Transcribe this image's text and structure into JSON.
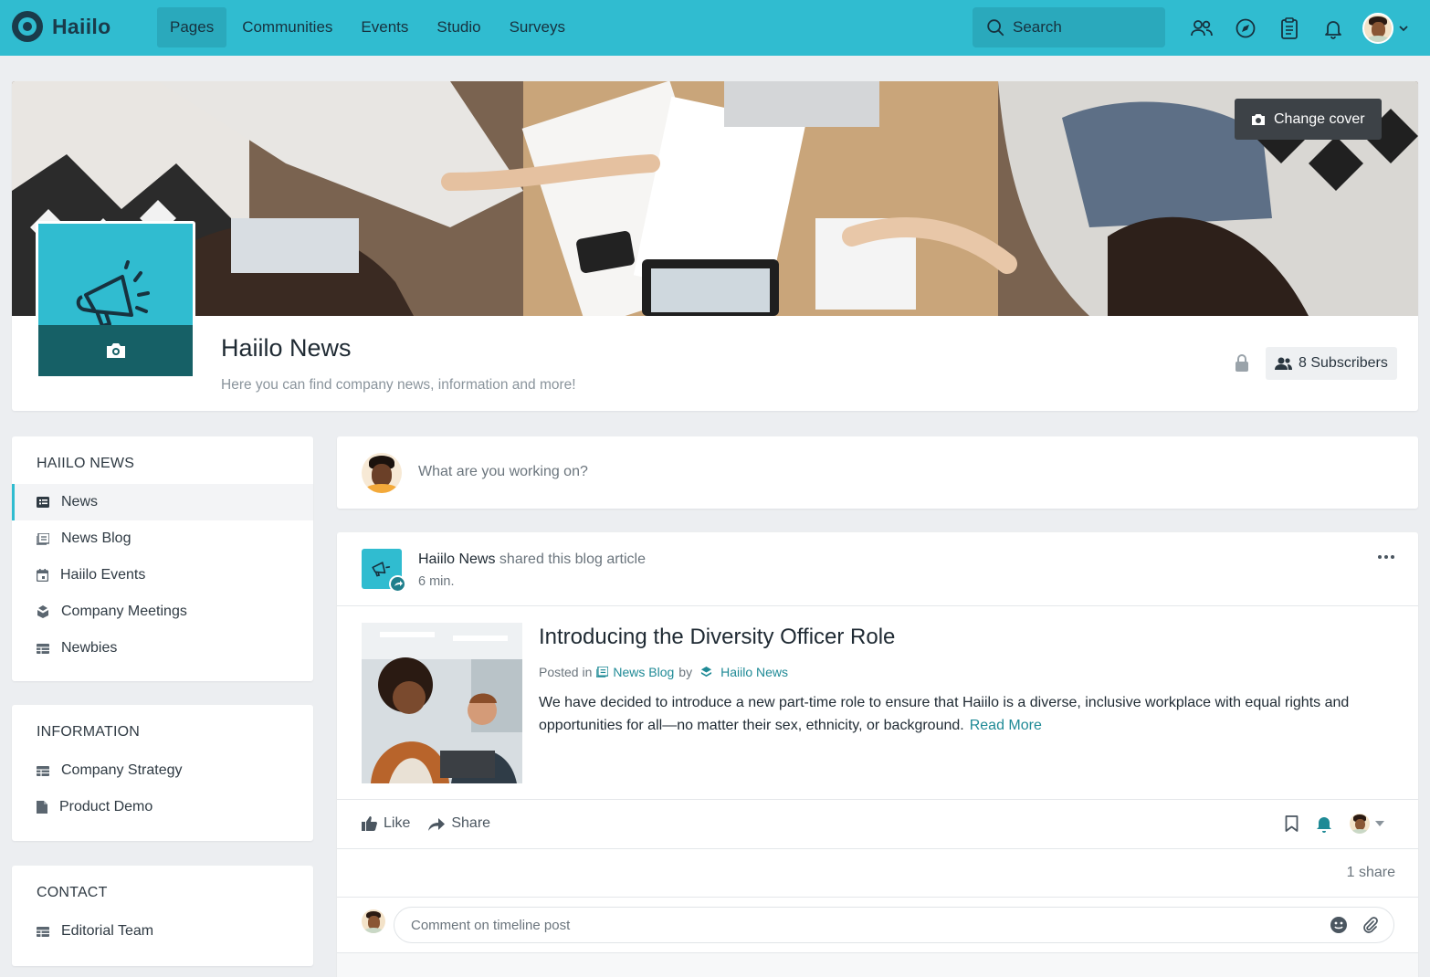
{
  "app": {
    "name": "Haiilo"
  },
  "nav": {
    "items": [
      "Pages",
      "Communities",
      "Events",
      "Studio",
      "Surveys"
    ],
    "active": "Pages"
  },
  "search": {
    "label": "Search"
  },
  "top_icons": [
    "people-icon",
    "compass-icon",
    "clipboard-icon",
    "bell-icon",
    "avatar",
    "chevron-down-icon"
  ],
  "cover": {
    "change_label": "Change cover"
  },
  "page": {
    "title": "Haiilo News",
    "description": "Here you can find company news, information and more!",
    "subscribers_label": "8 Subscribers"
  },
  "sidebar": {
    "sections": [
      {
        "heading": "HAIILO NEWS",
        "items": [
          {
            "label": "News",
            "icon": "feed-icon",
            "active": true
          },
          {
            "label": "News Blog",
            "icon": "blog-icon"
          },
          {
            "label": "Haiilo Events",
            "icon": "calendar-icon"
          },
          {
            "label": "Company Meetings",
            "icon": "meeting-icon"
          },
          {
            "label": "Newbies",
            "icon": "table-icon"
          }
        ]
      },
      {
        "heading": "INFORMATION",
        "items": [
          {
            "label": "Company Strategy",
            "icon": "table-icon"
          },
          {
            "label": "Product Demo",
            "icon": "document-icon"
          }
        ]
      },
      {
        "heading": "CONTACT",
        "items": [
          {
            "label": "Editorial Team",
            "icon": "table-icon"
          }
        ]
      }
    ]
  },
  "composer": {
    "placeholder": "What are you working on?"
  },
  "post": {
    "author": "Haiilo News",
    "action_text": "shared this blog article",
    "time": "6 min.",
    "article": {
      "title": "Introducing the Diversity Officer Role",
      "posted_in_prefix": "Posted in",
      "posted_in_app": "News Blog",
      "by": "by",
      "by_author": "Haiilo News",
      "excerpt": "We have decided to introduce a new part-time role to ensure that Haiilo is a diverse, inclusive workplace with equal rights and opportunities for all—no matter their sex, ethnicity, or background.",
      "read_more": "Read More"
    },
    "like_label": "Like",
    "share_label": "Share",
    "shares_count": "1 share",
    "comment_placeholder": "Comment on timeline post"
  },
  "colors": {
    "brand": "#30bcd0",
    "brand_dark": "#166066",
    "link": "#1f8a96"
  }
}
